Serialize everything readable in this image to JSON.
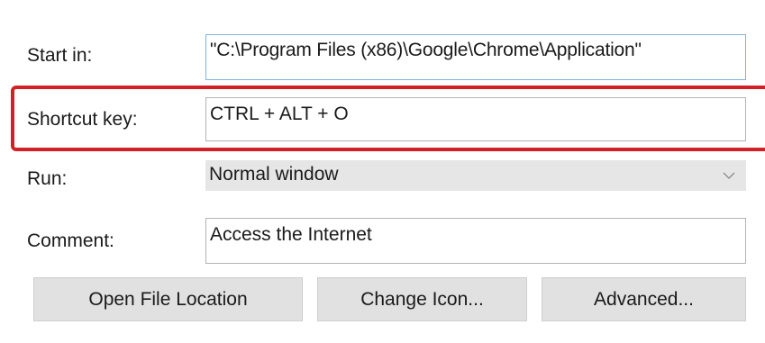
{
  "fields": {
    "start_in": {
      "label": "Start in:",
      "value": "\"C:\\Program Files (x86)\\Google\\Chrome\\Application\""
    },
    "shortcut_key": {
      "label": "Shortcut key:",
      "value": "CTRL + ALT + O"
    },
    "run": {
      "label": "Run:",
      "selected": "Normal window",
      "icon": "chevron-down-icon"
    },
    "comment": {
      "label": "Comment:",
      "value": "Access the Internet"
    }
  },
  "buttons": {
    "open_file_location": "Open File Location",
    "change_icon": "Change Icon...",
    "advanced": "Advanced..."
  },
  "colors": {
    "highlight": "#d32027",
    "button_bg": "#e1e1e1",
    "select_bg": "#e6e6e6",
    "focus_border": "#7fb3d9"
  }
}
